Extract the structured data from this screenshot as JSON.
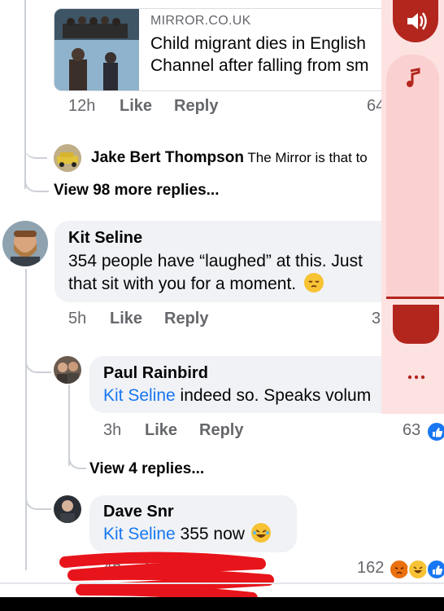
{
  "link_card": {
    "source": "MIRROR.CO.UK",
    "title_line1": "Child migrant dies in English",
    "title_line2": "Channel after falling from sm"
  },
  "post_meta": {
    "time": "12h",
    "like": "Like",
    "reply": "Reply",
    "count": "64"
  },
  "jake": {
    "name": "Jake Bert Thompson",
    "text": "The Mirror is that to"
  },
  "view_more": "View 98 more replies...",
  "kit": {
    "name": "Kit Seline",
    "line1": "354 people have “laughed” at this. Just",
    "line2": "that sit with you for a moment.",
    "time": "5h",
    "like": "Like",
    "reply": "Reply",
    "count": "3"
  },
  "paul": {
    "name": "Paul Rainbird",
    "mention": "Kit Seline",
    "text": " indeed so. Speaks volum",
    "time": "3h",
    "like": "Like",
    "reply": "Reply",
    "count": "63"
  },
  "view_4": "View 4 replies...",
  "dave": {
    "name": "Dave Snr",
    "mention": "Kit Seline",
    "text": " 355 now",
    "time": "4h",
    "like": "Like",
    "count": "162"
  },
  "overlay": {
    "icons": [
      "speaker-icon",
      "music-note-icon",
      "more-dots-icon"
    ],
    "accent": "#b3261e",
    "panel_bg": "#fde2e2"
  },
  "colors": {
    "mention": "#1877f2",
    "meta": "#65676b",
    "bubble": "#f0f2f5",
    "scribble": "#e8141b"
  }
}
